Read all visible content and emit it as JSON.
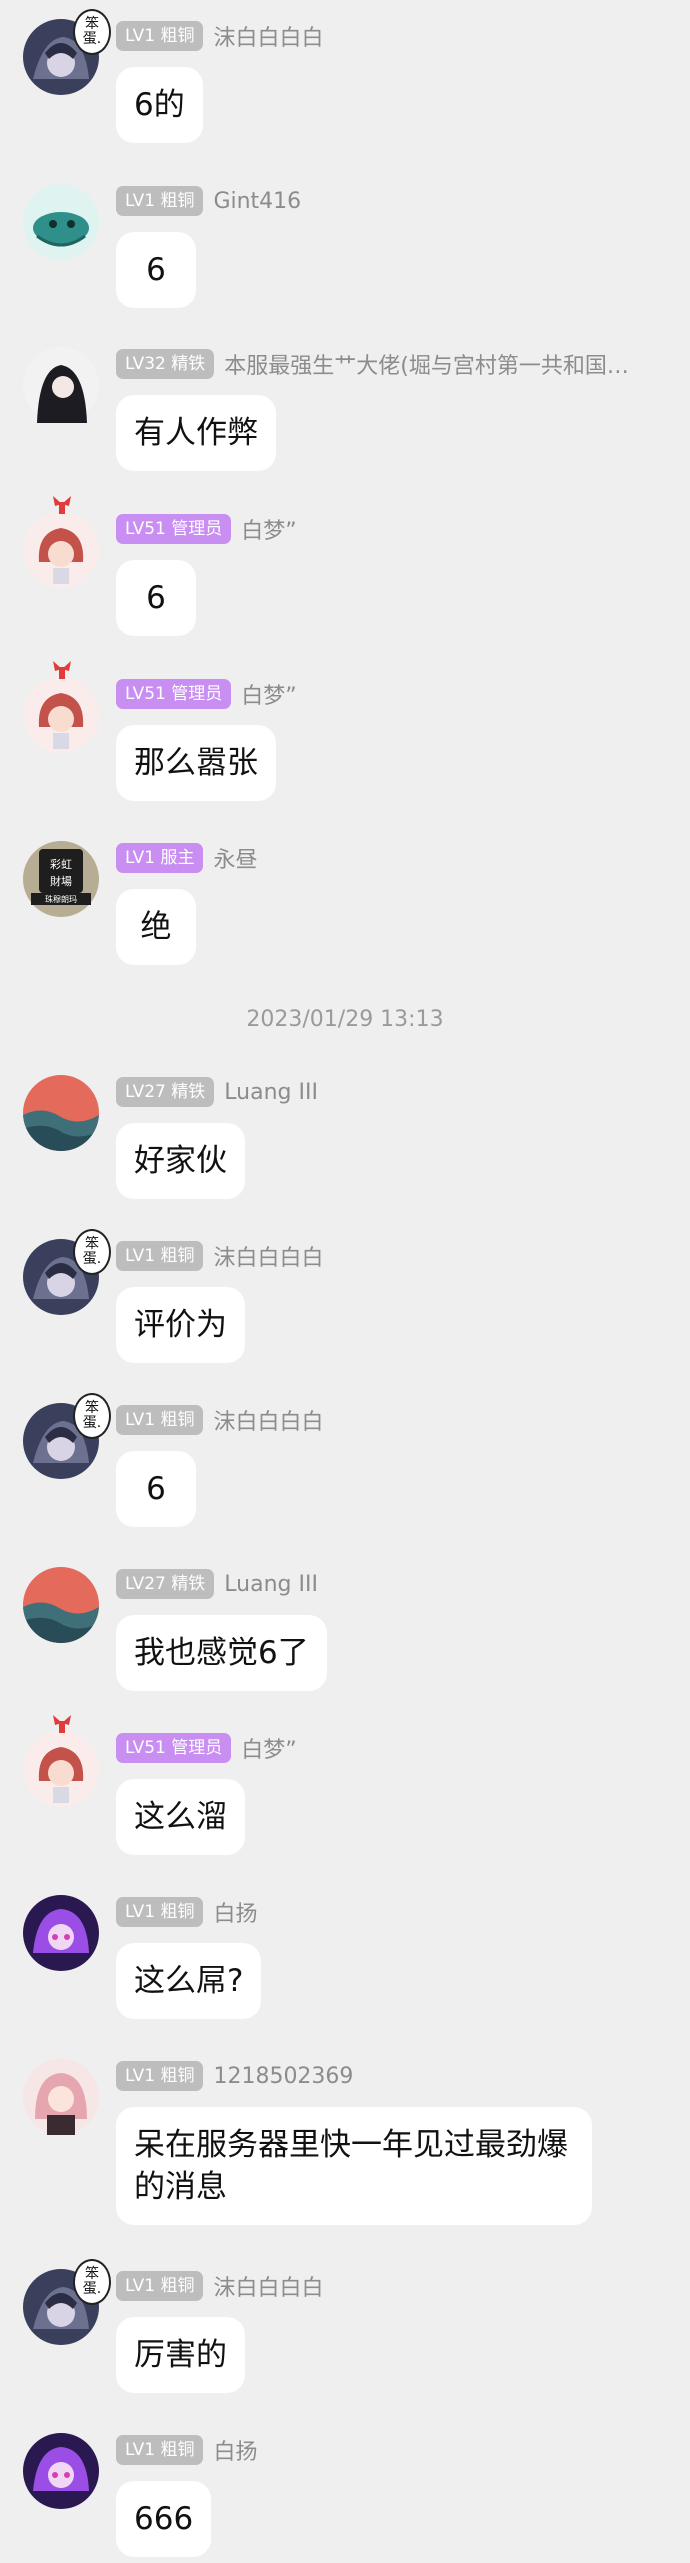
{
  "timestamp": "2023/01/29 13:13",
  "messages": [
    {
      "avatar": "anime-girl-dark",
      "level": "LV1 粗铜",
      "badge_color": "gray",
      "nickname": "沫白白白白",
      "text": "6的"
    },
    {
      "avatar": "green-creature",
      "level": "LV1 粗铜",
      "badge_color": "gray",
      "nickname": "Gint416",
      "text": "6"
    },
    {
      "avatar": "dark-hair-girl",
      "level": "LV32 精铁",
      "badge_color": "gray",
      "nickname": "本服最强生艹大佬(堀与宫村第一共和国…",
      "text": "有人作弊"
    },
    {
      "avatar": "red-hair-girl",
      "level": "LV51 管理员",
      "badge_color": "purple",
      "nickname": "白梦”",
      "text": "6"
    },
    {
      "avatar": "red-hair-girl",
      "level": "LV51 管理员",
      "badge_color": "purple",
      "nickname": "白梦”",
      "text": "那么嚣张"
    },
    {
      "avatar": "sign-board",
      "level": "LV1 服主",
      "badge_color": "purple",
      "nickname": "永昼",
      "text": "绝"
    },
    {
      "avatar": "sea-sunset",
      "level": "LV27 精铁",
      "badge_color": "gray",
      "nickname": "Luang III",
      "text": "好家伙"
    },
    {
      "avatar": "anime-girl-dark",
      "level": "LV1 粗铜",
      "badge_color": "gray",
      "nickname": "沫白白白白",
      "text": "评价为"
    },
    {
      "avatar": "anime-girl-dark",
      "level": "LV1 粗铜",
      "badge_color": "gray",
      "nickname": "沫白白白白",
      "text": "6"
    },
    {
      "avatar": "sea-sunset",
      "level": "LV27 精铁",
      "badge_color": "gray",
      "nickname": "Luang III",
      "text": "我也感觉6了"
    },
    {
      "avatar": "red-hair-girl",
      "level": "LV51 管理员",
      "badge_color": "purple",
      "nickname": "白梦”",
      "text": "这么溜"
    },
    {
      "avatar": "purple-girl",
      "level": "LV1 粗铜",
      "badge_color": "gray",
      "nickname": "白扬",
      "text": "这么屌?"
    },
    {
      "avatar": "pink-hair-girl",
      "level": "LV1 粗铜",
      "badge_color": "gray",
      "nickname": "1218502369",
      "text": "呆在服务器里快一年见过最劲爆的消息"
    },
    {
      "avatar": "anime-girl-dark",
      "level": "LV1 粗铜",
      "badge_color": "gray",
      "nickname": "沫白白白白",
      "text": "厉害的"
    },
    {
      "avatar": "purple-girl",
      "level": "LV1 粗铜",
      "badge_color": "gray",
      "nickname": "白扬",
      "text": "666"
    }
  ],
  "avatar_overlays": {
    "speech_text": "笨\n蛋.",
    "sign_text_1": "彩虹",
    "sign_text_2": "財場",
    "sign_text_3": "珠穆朗玛"
  },
  "colors": {
    "background": "#efefef",
    "badge_gray": "#bdbdbd",
    "badge_purple": "#c98ef2",
    "nickname": "#8c8c8c",
    "timestamp": "#9a9a9a"
  }
}
